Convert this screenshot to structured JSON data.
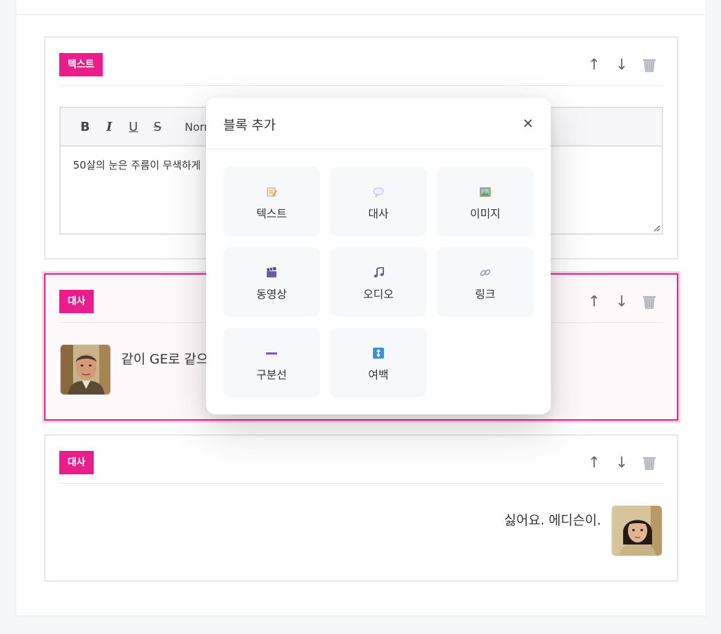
{
  "blocks": [
    {
      "type_label": "텍스트",
      "editor": {
        "toolbar": {
          "bold": "B",
          "italic": "I",
          "underline": "U",
          "strike": "S",
          "format_select": "Norr"
        },
        "content": "50살의 눈은 주름이 무색하게"
      }
    },
    {
      "type_label": "대사",
      "selected": true,
      "text": "같이 GE로 같으"
    },
    {
      "type_label": "대사",
      "text": "싫어요. 에디슨이."
    }
  ],
  "actions": {
    "up": "↑",
    "down": "↓"
  },
  "modal": {
    "title": "블록 추가",
    "options": [
      {
        "label": "텍스트",
        "icon": "memo-icon"
      },
      {
        "label": "대사",
        "icon": "speech-bubble-icon"
      },
      {
        "label": "이미지",
        "icon": "picture-icon"
      },
      {
        "label": "동영상",
        "icon": "clapper-icon"
      },
      {
        "label": "오디오",
        "icon": "music-note-icon"
      },
      {
        "label": "링크",
        "icon": "link-icon"
      },
      {
        "label": "구분선",
        "icon": "divider-icon"
      },
      {
        "label": "여백",
        "icon": "updown-arrow-icon"
      }
    ]
  },
  "colors": {
    "accent": "#e91e8c",
    "border": "#e6e6e6",
    "option_bg": "#f7f8fa"
  }
}
